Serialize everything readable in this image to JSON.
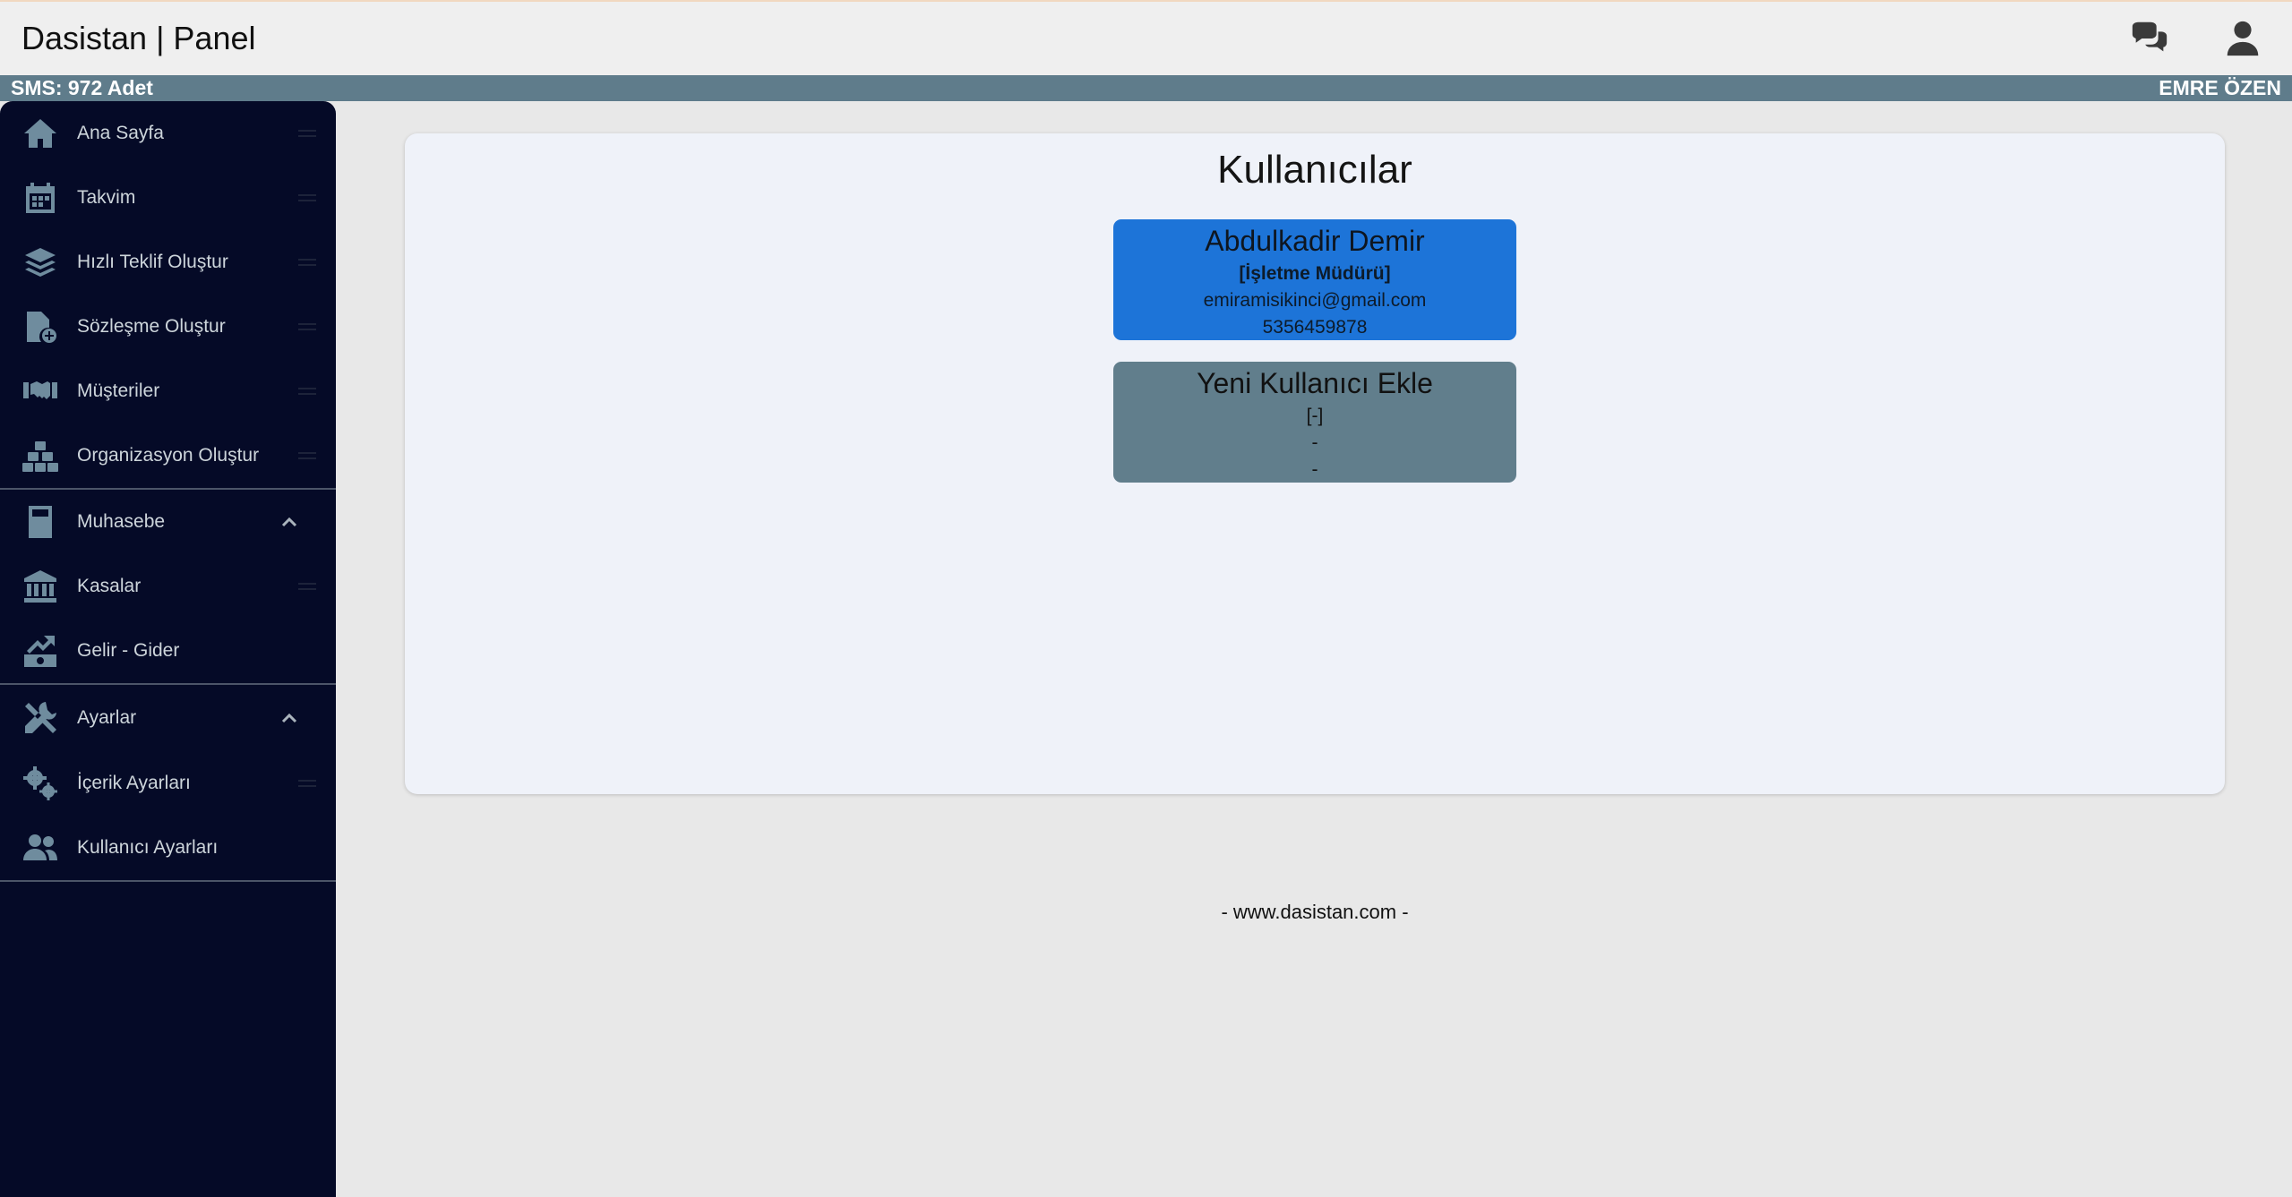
{
  "header": {
    "title": "Dasistan | Panel",
    "icons": [
      "chat-icon",
      "user-icon"
    ]
  },
  "status": {
    "sms": "SMS: 972 Adet",
    "user": "EMRE ÖZEN"
  },
  "sidebar": {
    "items": [
      {
        "label": "Ana Sayfa",
        "icon": "home-icon"
      },
      {
        "label": "Takvim",
        "icon": "calendar-icon"
      },
      {
        "label": "Hızlı Teklif Oluştur",
        "icon": "layers-icon"
      },
      {
        "label": "Sözleşme Oluştur",
        "icon": "file-plus-icon"
      },
      {
        "label": "Müşteriler",
        "icon": "handshake-icon"
      },
      {
        "label": "Organizasyon Oluştur",
        "icon": "cubes-icon"
      }
    ],
    "groups": [
      {
        "label": "Muhasebe",
        "icon": "calculator-icon",
        "items": [
          {
            "label": "Kasalar",
            "icon": "bank-icon"
          },
          {
            "label": "Gelir - Gider",
            "icon": "money-chart-icon"
          }
        ]
      },
      {
        "label": "Ayarlar",
        "icon": "tools-icon",
        "items": [
          {
            "label": "İçerik Ayarları",
            "icon": "gears-icon"
          },
          {
            "label": "Kullanıcı Ayarları",
            "icon": "users-icon"
          }
        ]
      }
    ]
  },
  "main": {
    "title": "Kullanıcılar",
    "users": [
      {
        "name": "Abdulkadir Demir",
        "role": "[İşletme Müdürü]",
        "email": "emiramisikinci@gmail.com",
        "phone": "5356459878"
      }
    ],
    "new_user": {
      "name": "Yeni Kullanıcı Ekle",
      "role": "[-]",
      "email": "-",
      "phone": "-"
    }
  },
  "footer": {
    "text": "- www.dasistan.com -"
  },
  "colors": {
    "sidebar_bg": "#050a27",
    "status_bg": "#5f7c8b",
    "user_card": "#1d74d8",
    "new_card": "#617e8c"
  }
}
